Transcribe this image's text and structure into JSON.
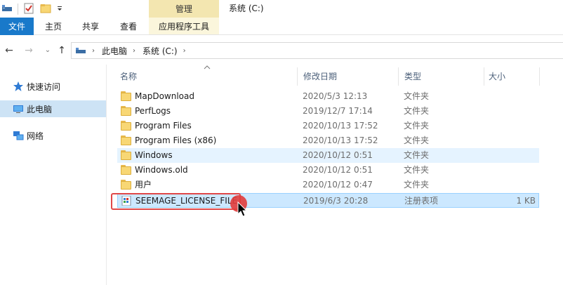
{
  "window": {
    "title": "系统 (C:)",
    "context_tab_group": "管理"
  },
  "ribbon": {
    "tabs": [
      {
        "label": "文件"
      },
      {
        "label": "主页"
      },
      {
        "label": "共享"
      },
      {
        "label": "查看"
      },
      {
        "label": "应用程序工具"
      }
    ]
  },
  "address": {
    "crumbs": [
      "此电脑",
      "系统 (C:)"
    ]
  },
  "sidebar": {
    "items": [
      {
        "label": "快速访问",
        "icon": "star-icon"
      },
      {
        "label": "此电脑",
        "icon": "computer-icon",
        "selected": true
      },
      {
        "label": "网络",
        "icon": "network-icon"
      }
    ]
  },
  "columns": {
    "name": "名称",
    "date": "修改日期",
    "type": "类型",
    "size": "大小"
  },
  "files": [
    {
      "name": "MapDownload",
      "date": "2020/5/3 12:13",
      "type": "文件夹",
      "size": "",
      "icon": "folder-icon"
    },
    {
      "name": "PerfLogs",
      "date": "2019/12/7 17:14",
      "type": "文件夹",
      "size": "",
      "icon": "folder-icon"
    },
    {
      "name": "Program Files",
      "date": "2020/10/13 17:52",
      "type": "文件夹",
      "size": "",
      "icon": "folder-icon"
    },
    {
      "name": "Program Files (x86)",
      "date": "2020/10/13 17:52",
      "type": "文件夹",
      "size": "",
      "icon": "folder-icon"
    },
    {
      "name": "Windows",
      "date": "2020/10/12 0:51",
      "type": "文件夹",
      "size": "",
      "icon": "folder-icon"
    },
    {
      "name": "Windows.old",
      "date": "2020/10/12 0:51",
      "type": "文件夹",
      "size": "",
      "icon": "folder-icon"
    },
    {
      "name": "用户",
      "date": "2020/10/12 0:47",
      "type": "文件夹",
      "size": "",
      "icon": "folder-icon"
    },
    {
      "name": "SEEMAGE_LICENSE_FILE",
      "date": "2019/6/3 20:28",
      "type": "注册表项",
      "size": "1 KB",
      "icon": "registry-file-icon"
    }
  ],
  "colors": {
    "file_tab": "#1979ca",
    "manage_tab": "#f3e6b0",
    "selection": "#cce8ff",
    "hover": "#e5f3ff",
    "annotation": "#e04848"
  }
}
